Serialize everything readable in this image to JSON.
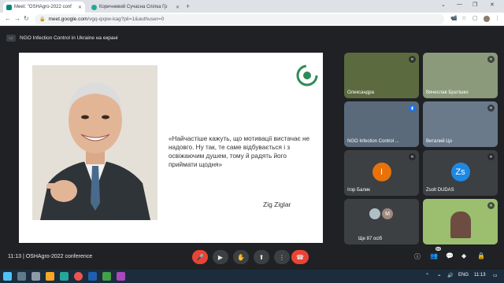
{
  "browser": {
    "tabs": [
      {
        "title": "Meet: \"OSHAgro-2022 conf",
        "active": true,
        "favicon_color": "#00897b"
      },
      {
        "title": "Коричневий Сучасна Спілка Гр",
        "active": false,
        "favicon_color": "#26a69a"
      }
    ],
    "new_tab_label": "+",
    "url_domain": "meet.google.com",
    "url_path": "/vgq-qxpw-kag?pli=1&authuser=0"
  },
  "meet": {
    "presenting_label": "NGO Infection Control in Ukraine на екрані",
    "slide": {
      "quote": "«Найчастіше кажуть, що мотивації вистачає не надовго. Ну так, те саме відбувається і з освіжаючим душем, тому й радять його приймати щодня»",
      "author": "Zig Ziglar"
    },
    "participants": [
      {
        "name": "Олександра",
        "muted": true,
        "avatar_letter": "",
        "bg": "#556b2f"
      },
      {
        "name": "Вячеслав Братішко",
        "muted": true,
        "avatar_letter": "",
        "bg": "#8a9a7a"
      },
      {
        "name": "NGO Infection Control ...",
        "muted": false,
        "avatar_letter": "",
        "bg": "#5a6a7a"
      },
      {
        "name": "Виталий Цо",
        "muted": true,
        "avatar_letter": "",
        "bg": "#6a7a8a"
      },
      {
        "name": "Ігор Балик",
        "muted": true,
        "avatar_letter": "І",
        "bg": "#3c4043",
        "avatar_color": "#e8710a"
      },
      {
        "name": "Zsolt DUDAS",
        "muted": true,
        "avatar_letter": "Zs",
        "bg": "#3c4043",
        "avatar_color": "#1e88e5"
      },
      {
        "name": "Ще 87 осіб",
        "muted": false,
        "avatar_letter": "M",
        "bg": "#3c4043",
        "avatar_color": "#a1887f"
      },
      {
        "name": "",
        "muted": true,
        "avatar_letter": "",
        "bg": "#9bbf6f"
      }
    ],
    "controls": {
      "time": "11:13",
      "meeting_name": "OSHAgro-2022 conference",
      "people_count": "90"
    }
  },
  "taskbar": {
    "language": "ENG",
    "clock": "11:13"
  },
  "colors": {
    "meet_bg": "#202124",
    "end_call": "#ea4335",
    "logo_green": "#2e8b57"
  }
}
